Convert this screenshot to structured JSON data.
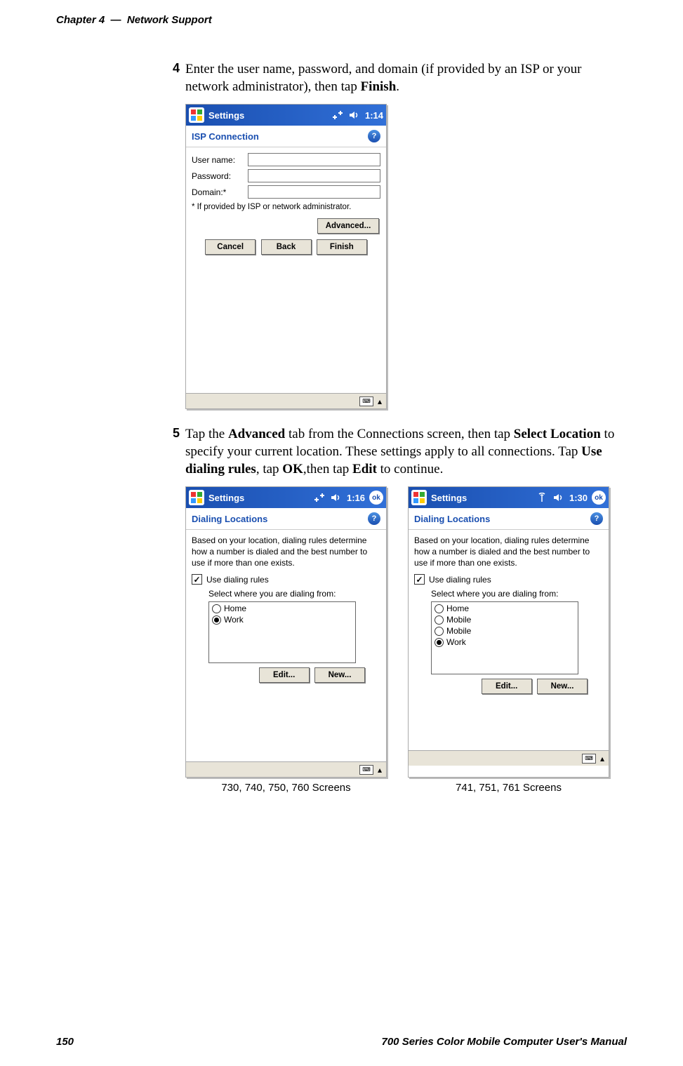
{
  "header": {
    "chapter": "Chapter 4",
    "sep": "—",
    "title": "Network Support"
  },
  "steps": {
    "s4": {
      "num": "4",
      "text_a": "Enter the user name, password, and domain (if provided by an ISP or your network administrator), then tap ",
      "b1": "Finish",
      "text_b": "."
    },
    "s5": {
      "num": "5",
      "t1": "Tap the ",
      "b1": "Advanced",
      "t2": " tab from the Connections screen, then tap ",
      "b2": "Select Location",
      "t3": " to specify your current location. These settings apply to all connections. Tap ",
      "b3": "Use dialing rules",
      "t4": ", tap ",
      "b4": "OK",
      "t5": ",then tap ",
      "b5": "Edit",
      "t6": " to continue."
    }
  },
  "pda1": {
    "titlebar": {
      "app": "Settings",
      "time": "1:14"
    },
    "sub": "ISP Connection",
    "labels": {
      "user": "User name:",
      "pass": "Password:",
      "dom": "Domain:*"
    },
    "hint": "* If provided by ISP or network administrator.",
    "btns": {
      "adv": "Advanced...",
      "cancel": "Cancel",
      "back": "Back",
      "finish": "Finish"
    }
  },
  "pda2": {
    "titlebar": {
      "app": "Settings",
      "time": "1:16",
      "ok": "ok"
    },
    "sub": "Dialing Locations",
    "para": "Based on your location, dialing rules determine how a number is dialed and the best number to use if more than one exists.",
    "chk": "Use dialing rules",
    "where": "Select where you are dialing from:",
    "opts": {
      "o1": "Home",
      "o2": "Work"
    },
    "btns": {
      "edit": "Edit...",
      "new": "New..."
    }
  },
  "pda3": {
    "titlebar": {
      "app": "Settings",
      "time": "1:30",
      "ok": "ok"
    },
    "sub": "Dialing Locations",
    "para": "Based on your location, dialing rules determine how a number is dialed and the best number to use if more than one exists.",
    "chk": "Use dialing rules",
    "where": "Select where you are dialing from:",
    "opts": {
      "o1": "Home",
      "o2": "Mobile",
      "o3": "Mobile",
      "o4": "Work"
    },
    "btns": {
      "edit": "Edit...",
      "new": "New..."
    }
  },
  "captions": {
    "left": "730, 740, 750, 760 Screens",
    "right": "741, 751, 761 Screens"
  },
  "footer": {
    "page": "150",
    "manual": "700 Series Color Mobile Computer User's Manual"
  }
}
